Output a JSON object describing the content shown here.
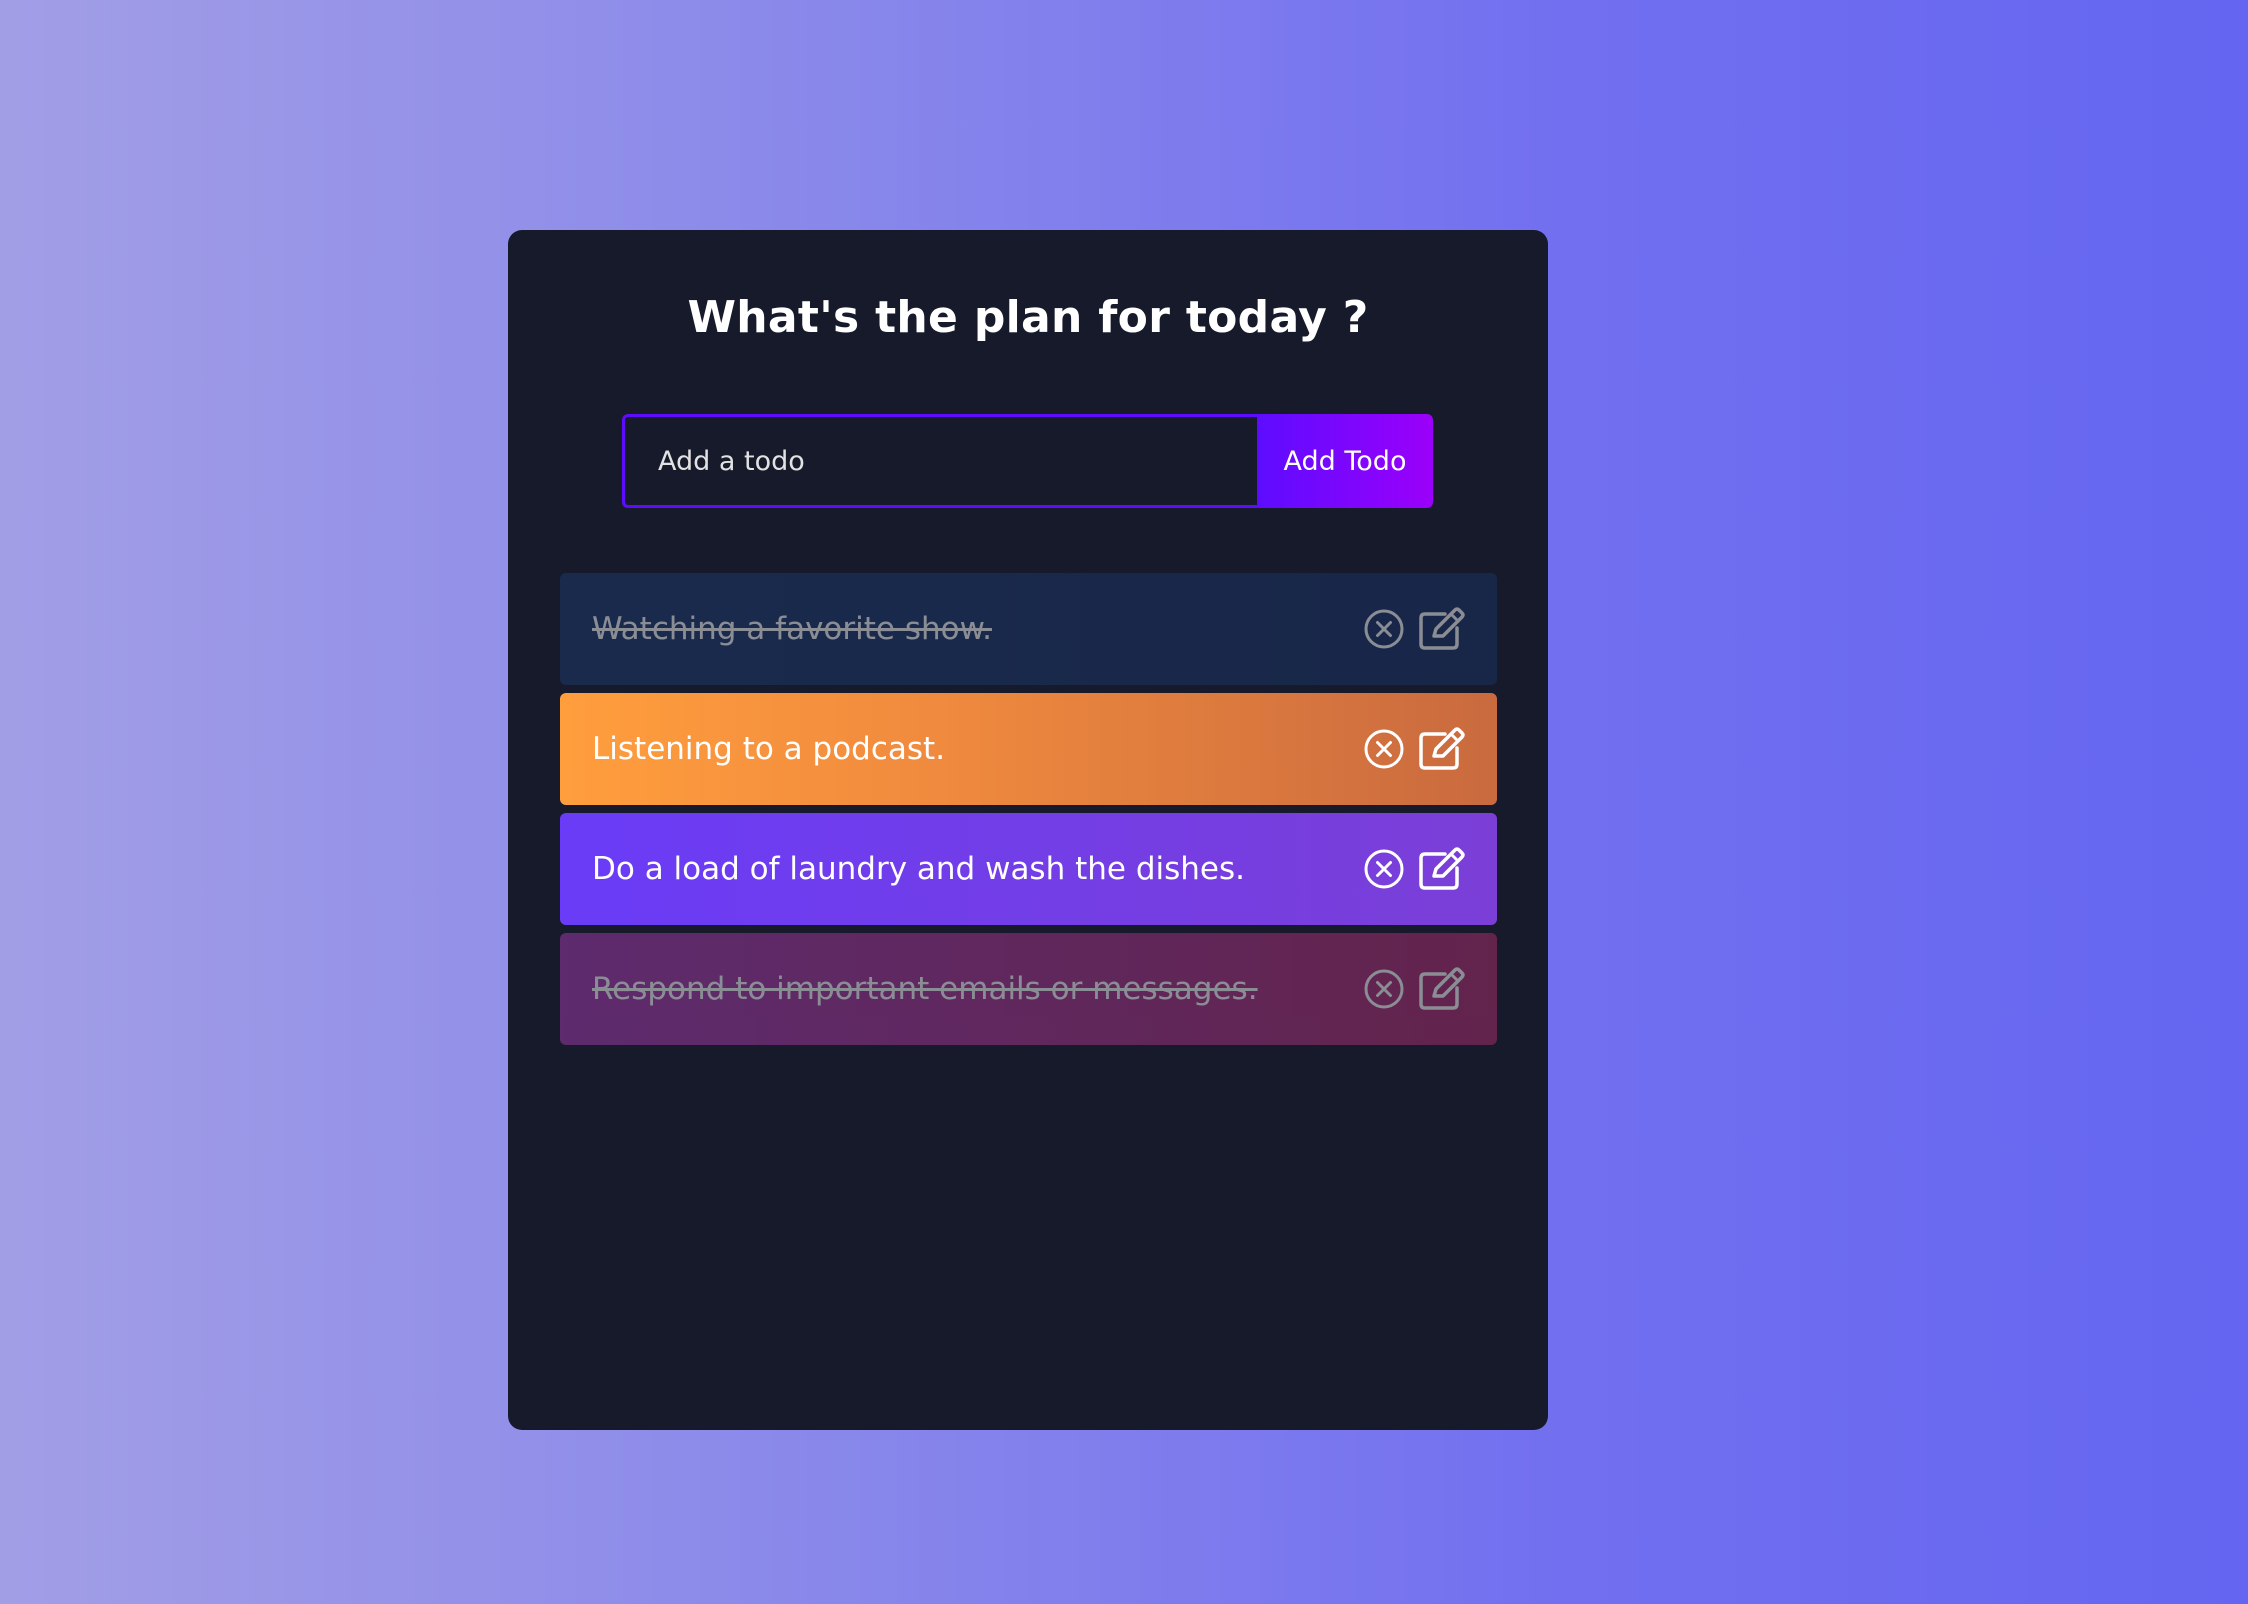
{
  "header": {
    "title": "What's the plan for today ?"
  },
  "form": {
    "input_placeholder": "Add a todo",
    "input_value": "",
    "add_button_label": "Add Todo"
  },
  "todos": [
    {
      "text": "Watching a favorite show.",
      "complete": true,
      "color": "#1c3b6f"
    },
    {
      "text": "Listening to a podcast.",
      "complete": false,
      "color": "#f08a3e"
    },
    {
      "text": "Do a load of laundry and wash the dishes.",
      "complete": false,
      "color": "#6a3cf7"
    },
    {
      "text": "Respond to important emails or messages.",
      "complete": true,
      "color": "#a33cb0"
    }
  ],
  "icons": {
    "delete": "close-circle-icon",
    "edit": "edit-icon"
  },
  "colors": {
    "background_start": "#a29ee6",
    "background_end": "#6466f1",
    "panel": "#171a2b",
    "accent": "#5d0cff",
    "accent_end": "#9b00fa"
  }
}
